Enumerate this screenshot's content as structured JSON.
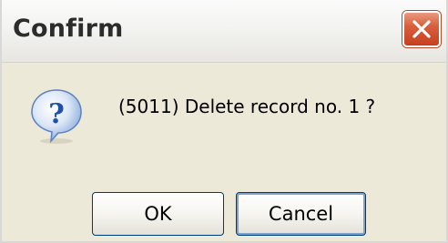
{
  "dialog": {
    "title": "Confirm",
    "message": "(5011) Delete record no. 1 ?",
    "icon": "question-icon",
    "ok_label": "OK",
    "cancel_label": "Cancel",
    "close_icon": "close-icon"
  },
  "colors": {
    "title_text": "#2c2c2c",
    "dialog_bg": "#ece9d8",
    "close_button": "#d9603d",
    "button_border": "#003c74",
    "focus_ring": "#7da2ce",
    "icon_blue": "#2f69c6"
  }
}
